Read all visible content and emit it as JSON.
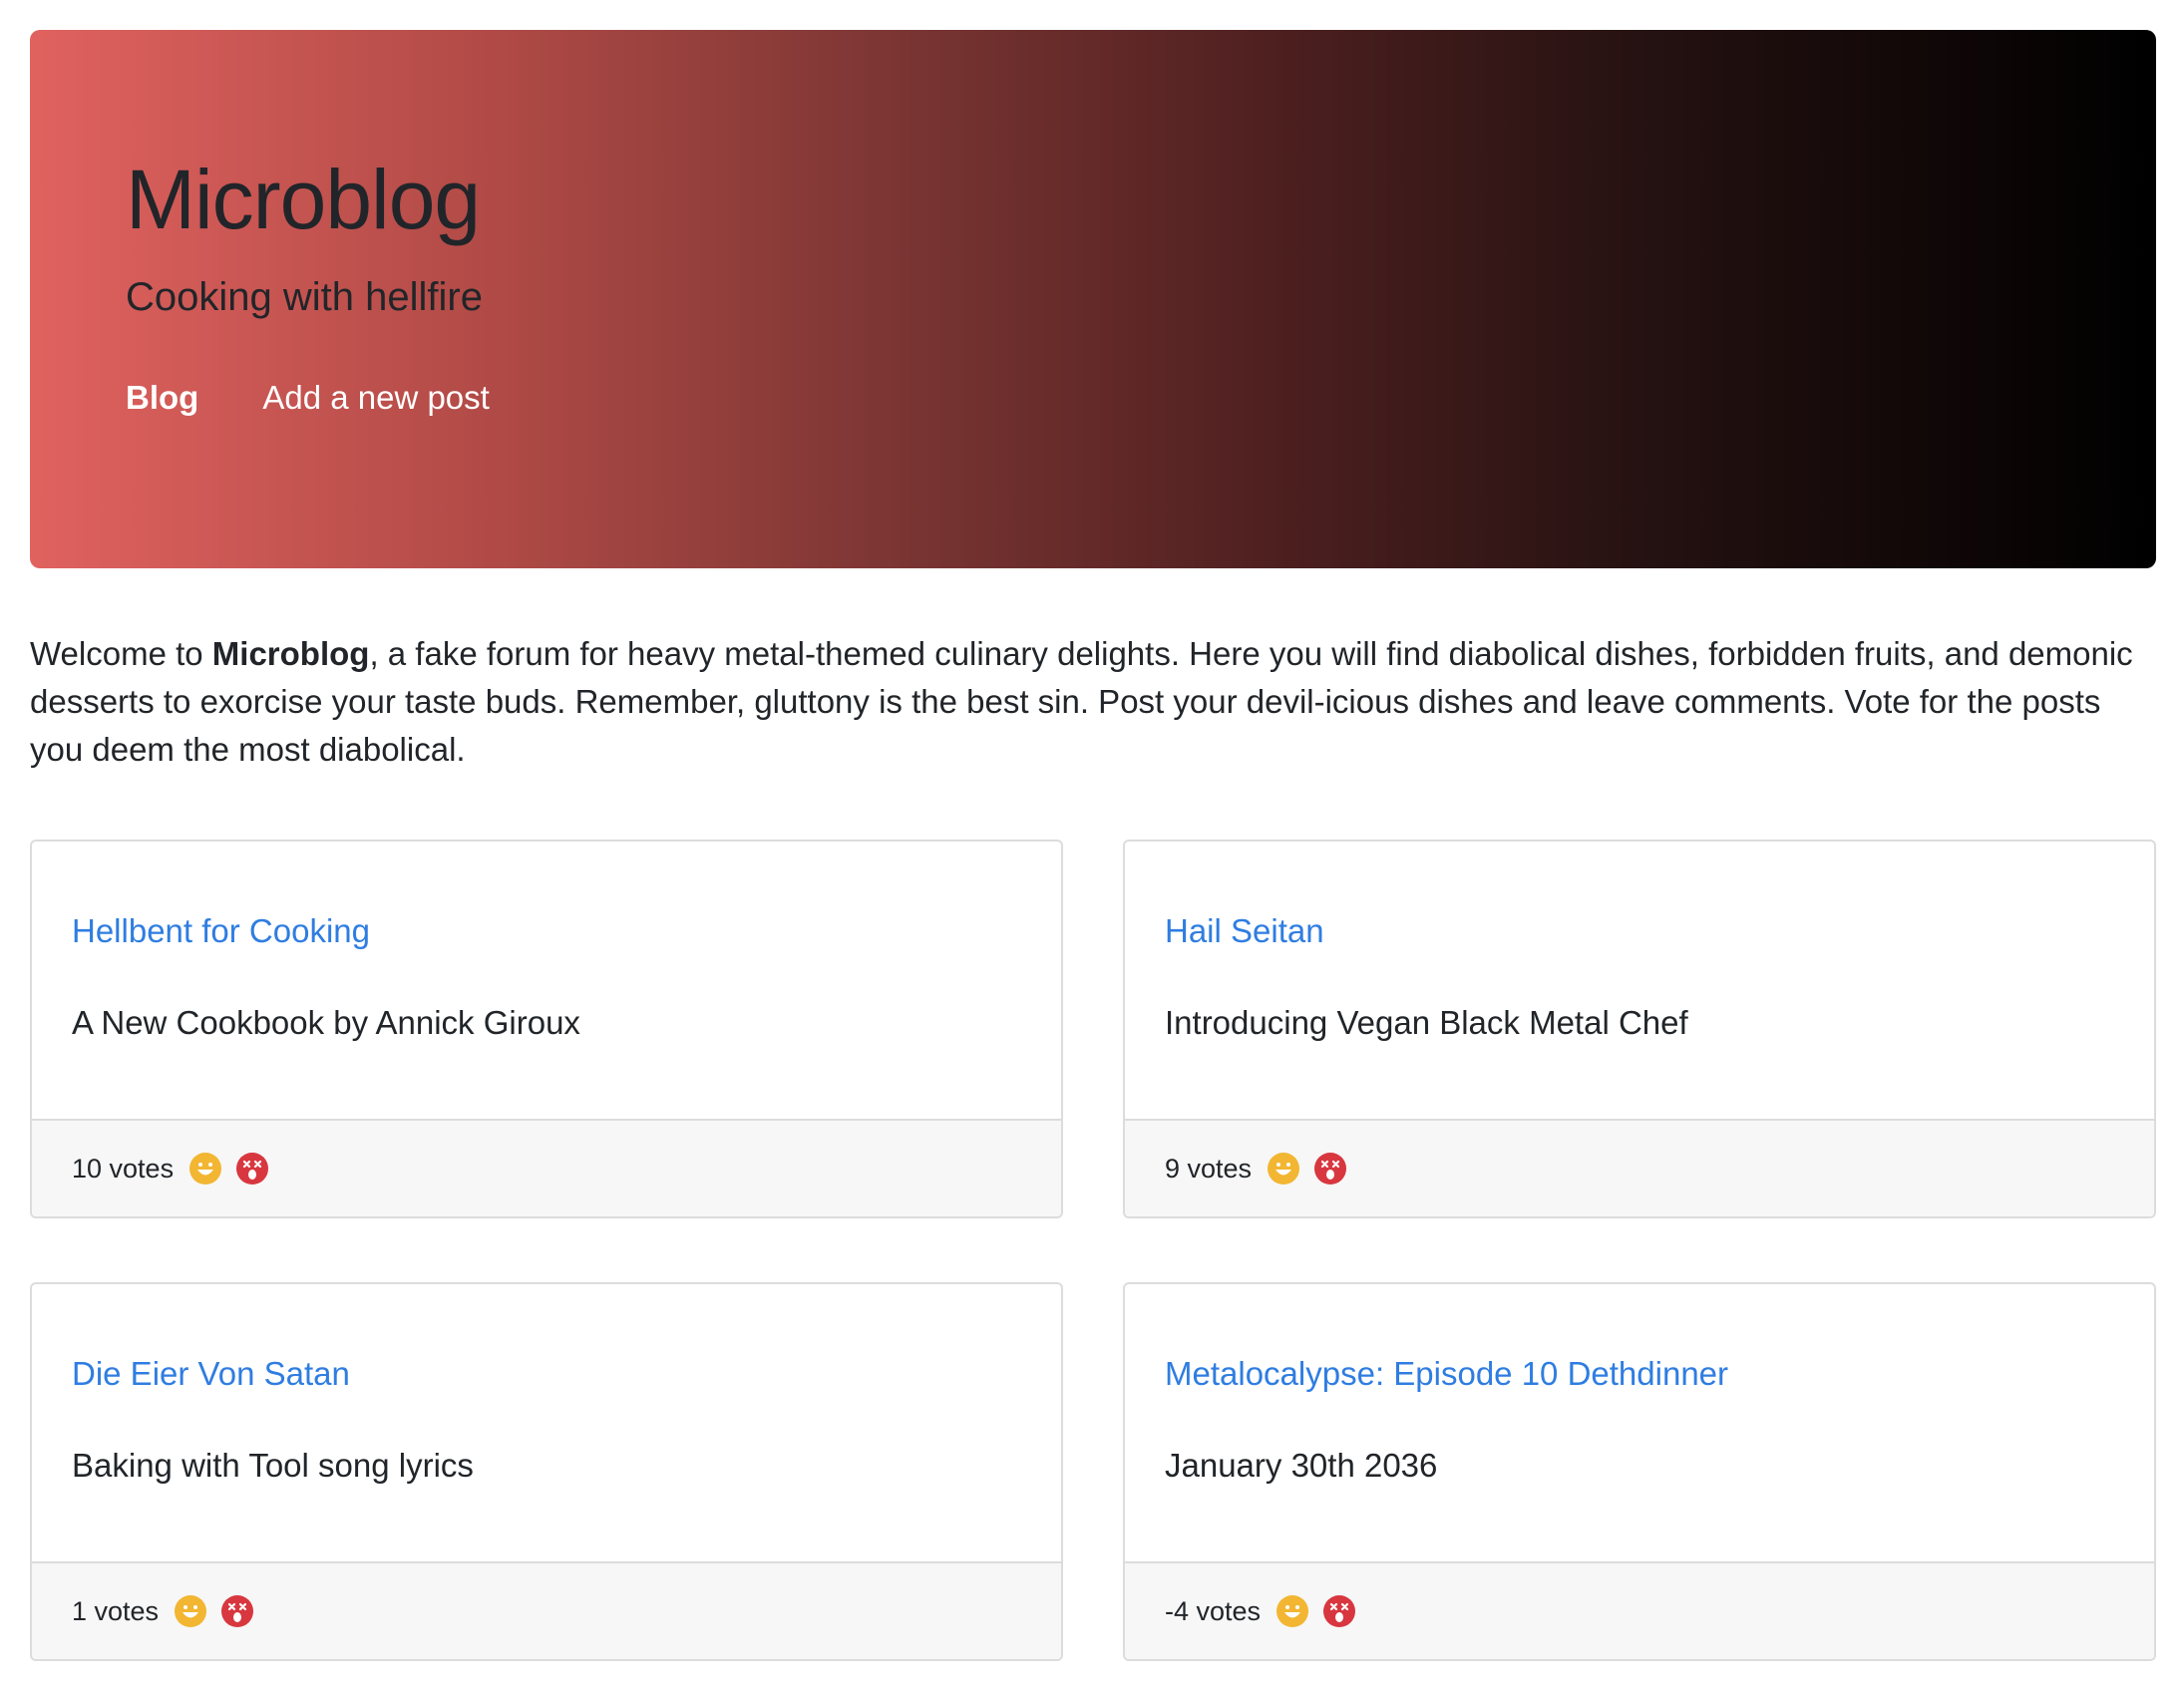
{
  "hero": {
    "title": "Microblog",
    "subtitle": "Cooking with hellfire",
    "nav": [
      {
        "label": "Blog",
        "active": true
      },
      {
        "label": "Add a new post",
        "active": false
      }
    ]
  },
  "intro": {
    "prefix": "Welcome to ",
    "brand": "Microblog",
    "suffix": ", a fake forum for heavy metal-themed culinary delights. Here you will find diabolical dishes, forbidden fruits, and demonic desserts to exorcise your taste buds. Remember, gluttony is the best sin. Post your devil-icious dishes and leave comments. Vote for the posts you deem the most diabolical."
  },
  "posts": [
    {
      "title": "Hellbent for Cooking",
      "subtitle": "A New Cookbook by Annick Giroux",
      "votes": "10 votes"
    },
    {
      "title": "Hail Seitan",
      "subtitle": "Introducing Vegan Black Metal Chef",
      "votes": "9 votes"
    },
    {
      "title": "Die Eier Von Satan",
      "subtitle": "Baking with Tool song lyrics",
      "votes": "1 votes"
    },
    {
      "title": "Metalocalypse: Episode 10 Dethdinner",
      "subtitle": "January 30th 2036",
      "votes": "-4 votes"
    }
  ],
  "icons": {
    "upvote": "grinning-face-icon",
    "downvote": "dizzy-face-icon"
  },
  "colors": {
    "link": "#2f7de1",
    "upvote": "#f2b632",
    "downvote": "#d8373f",
    "hero_start": "#e0625f",
    "hero_end": "#000000"
  }
}
